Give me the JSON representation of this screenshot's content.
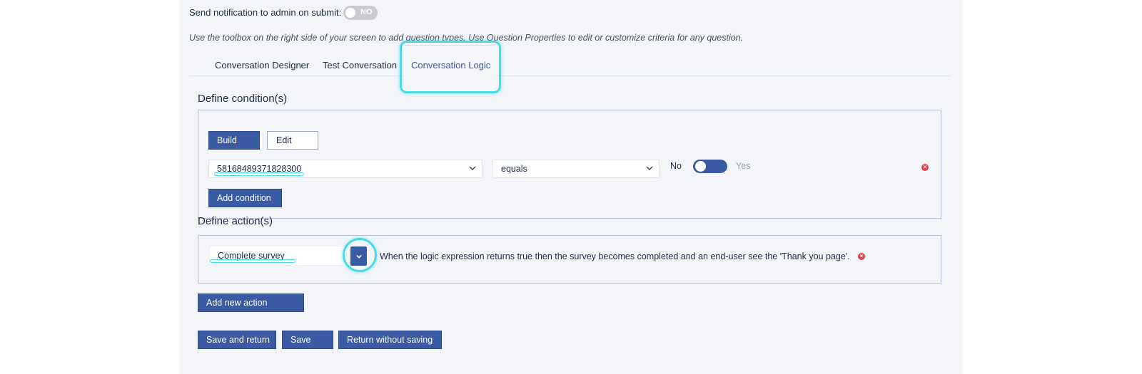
{
  "notification": {
    "label": "Send notification to admin on submit:",
    "toggle_text": "NO"
  },
  "hint": "Use the toolbox on the right side of your screen to add question types. Use Question Properties to edit or customize criteria for any question.",
  "tabs": [
    {
      "label": "Conversation Designer"
    },
    {
      "label": "Test Conversation"
    },
    {
      "label": "Conversation Logic"
    }
  ],
  "conditions": {
    "title": "Define condition(s)",
    "build_label": "Build",
    "edit_label": "Edit",
    "question_value": "58168489371828300",
    "operator_value": "equals",
    "toggle_no": "No",
    "toggle_yes": "Yes",
    "add_condition_label": "Add condition"
  },
  "actions": {
    "title": "Define action(s)",
    "action_value": "Complete survey",
    "description": "When the logic expression returns true then the survey becomes completed and an end-user see the 'Thank you page'.",
    "add_action_label": "Add new action"
  },
  "footer": {
    "save_return_label": "Save and return",
    "save_label": "Save",
    "return_no_save_label": "Return without saving"
  },
  "colors": {
    "primary": "#3a5ba4",
    "highlight": "#48dbe6",
    "panel_bg": "#f4f5f9",
    "remove": "#e0454e"
  },
  "icons": [
    "chevron-down-icon",
    "remove-icon"
  ]
}
